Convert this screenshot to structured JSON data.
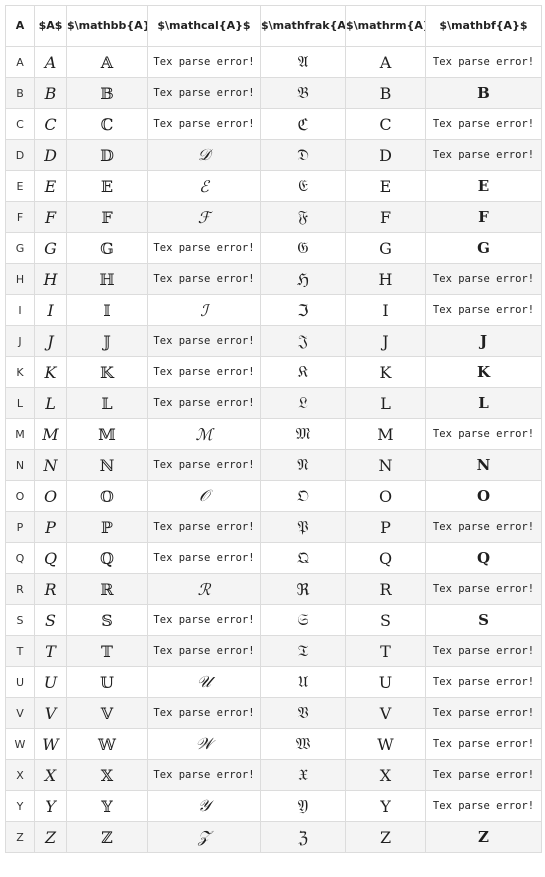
{
  "headers": [
    "A",
    "$A$",
    "$\\mathbb{A}$",
    "$\\mathcal{A}$",
    "$\\mathfrak{A}$",
    "$\\mathrm{A}$",
    "$\\mathbf{A}$"
  ],
  "rows": [
    [
      "A",
      "𝐴",
      "𝔸",
      "Tex parse error!",
      "𝔄",
      "A",
      "Tex parse error!"
    ],
    [
      "B",
      "𝐵",
      "𝔹",
      "Tex parse error!",
      "𝔅",
      "B",
      "B"
    ],
    [
      "C",
      "𝐶",
      "ℂ",
      "Tex parse error!",
      "ℭ",
      "C",
      "Tex parse error!"
    ],
    [
      "D",
      "𝐷",
      "𝔻",
      "𝒟",
      "𝔇",
      "D",
      "Tex parse error!"
    ],
    [
      "E",
      "𝐸",
      "𝔼",
      "ℰ",
      "𝔈",
      "E",
      "E"
    ],
    [
      "F",
      "𝐹",
      "𝔽",
      "ℱ",
      "𝔉",
      "F",
      "F"
    ],
    [
      "G",
      "𝐺",
      "𝔾",
      "Tex parse error!",
      "𝔊",
      "G",
      "G"
    ],
    [
      "H",
      "𝐻",
      "ℍ",
      "Tex parse error!",
      "ℌ",
      "H",
      "Tex parse error!"
    ],
    [
      "I",
      "𝐼",
      "𝕀",
      "ℐ",
      "ℑ",
      "I",
      "Tex parse error!"
    ],
    [
      "J",
      "𝐽",
      "𝕁",
      "Tex parse error!",
      "𝔍",
      "J",
      "J"
    ],
    [
      "K",
      "𝐾",
      "𝕂",
      "Tex parse error!",
      "𝔎",
      "K",
      "K"
    ],
    [
      "L",
      "𝐿",
      "𝕃",
      "Tex parse error!",
      "𝔏",
      "L",
      "L"
    ],
    [
      "M",
      "𝑀",
      "𝕄",
      "ℳ",
      "𝔐",
      "M",
      "Tex parse error!"
    ],
    [
      "N",
      "𝑁",
      "ℕ",
      "Tex parse error!",
      "𝔑",
      "N",
      "N"
    ],
    [
      "O",
      "𝑂",
      "𝕆",
      "𝒪",
      "𝔒",
      "O",
      "O"
    ],
    [
      "P",
      "𝑃",
      "ℙ",
      "Tex parse error!",
      "𝔓",
      "P",
      "Tex parse error!"
    ],
    [
      "Q",
      "𝑄",
      "ℚ",
      "Tex parse error!",
      "𝔔",
      "Q",
      "Q"
    ],
    [
      "R",
      "𝑅",
      "ℝ",
      "ℛ",
      "ℜ",
      "R",
      "Tex parse error!"
    ],
    [
      "S",
      "𝑆",
      "𝕊",
      "Tex parse error!",
      "𝔖",
      "S",
      "S"
    ],
    [
      "T",
      "𝑇",
      "𝕋",
      "Tex parse error!",
      "𝔗",
      "T",
      "Tex parse error!"
    ],
    [
      "U",
      "𝑈",
      "𝕌",
      "𝒰",
      "𝔘",
      "U",
      "Tex parse error!"
    ],
    [
      "V",
      "𝑉",
      "𝕍",
      "Tex parse error!",
      "𝔙",
      "V",
      "Tex parse error!"
    ],
    [
      "W",
      "𝑊",
      "𝕎",
      "𝒲",
      "𝔚",
      "W",
      "Tex parse error!"
    ],
    [
      "X",
      "𝑋",
      "𝕏",
      "Tex parse error!",
      "𝔛",
      "X",
      "Tex parse error!"
    ],
    [
      "Y",
      "𝑌",
      "𝕐",
      "𝒴",
      "𝔜",
      "Y",
      "Tex parse error!"
    ],
    [
      "Z",
      "𝑍",
      "ℤ",
      "𝒵",
      "ℨ",
      "Z",
      "Z"
    ]
  ]
}
